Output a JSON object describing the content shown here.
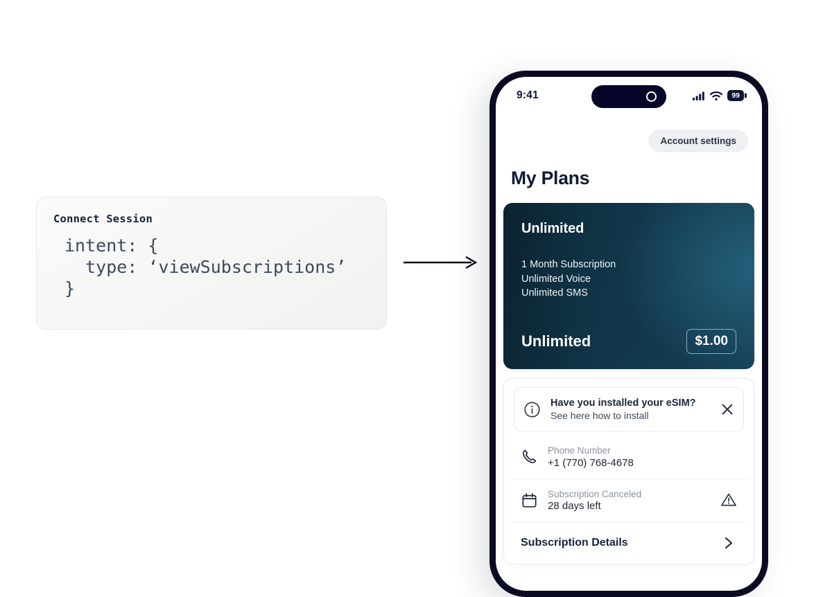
{
  "session": {
    "title": "Connect Session",
    "code": "intent: {\n  type: ‘viewSubscriptions’\n}"
  },
  "flow": {
    "arrow_icon": "arrow-right-icon"
  },
  "phone": {
    "status_bar": {
      "time": "9:41",
      "signal_icon": "cellular-signal-icon",
      "wifi_icon": "wifi-icon",
      "battery_level": "99",
      "camera_icon": "camera-dot-icon"
    },
    "header": {
      "account_settings_label": "Account settings",
      "page_title": "My Plans"
    },
    "plan_card": {
      "name": "Unlimited",
      "features": "1 Month Subscription\nUnlimited Voice\nUnlimited SMS",
      "bottom_name": "Unlimited",
      "price": "$1.00",
      "gradient_from": "#0b2230",
      "gradient_to": "#1b5068"
    },
    "details_card": {
      "esim_banner": {
        "icon": "info-circle-icon",
        "title": "Have you installed your eSIM?",
        "subtitle": "See here how to install",
        "close_icon": "close-icon"
      },
      "rows": [
        {
          "icon": "phone-handset-icon",
          "label": "Phone Number",
          "value": "+1 (770) 768-4678",
          "trailing_icon": ""
        },
        {
          "icon": "calendar-icon",
          "label": "Subscription Canceled",
          "value": "28 days left",
          "trailing_icon": "warning-triangle-icon"
        }
      ],
      "details_link": {
        "label": "Subscription Details",
        "chevron_icon": "chevron-right-icon"
      }
    }
  }
}
